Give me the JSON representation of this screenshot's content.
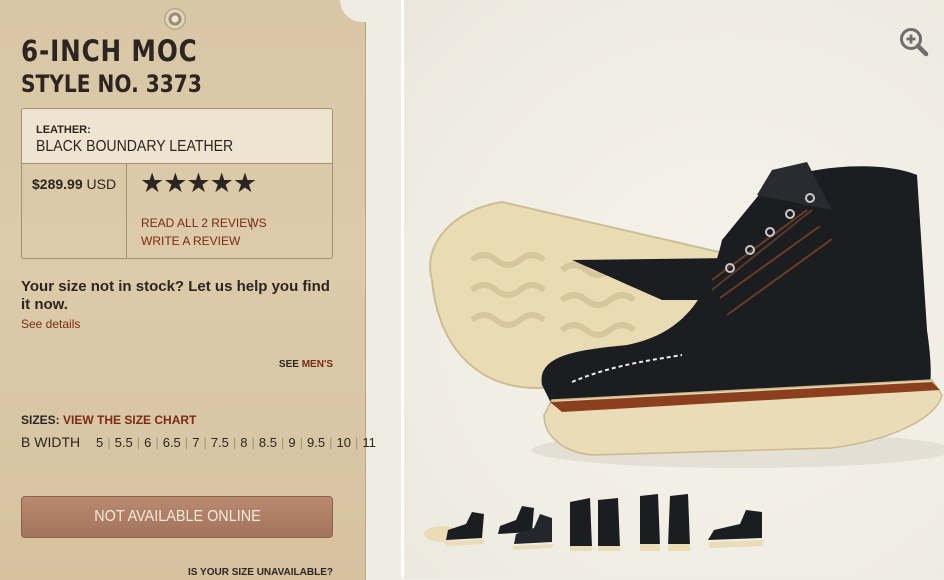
{
  "product": {
    "title": "6-INCH MOC",
    "style_no": "STYLE NO. 3373",
    "leather_label": "LEATHER:",
    "leather_value": "BLACK BOUNDARY LEATHER",
    "price": "$289.99",
    "currency": "USD",
    "rating_stars": 5,
    "stars_text": "★★★★★",
    "reviews_link": "READ ALL 2 REVIEWS",
    "separator": "|",
    "write_review": "WRITE A REVIEW"
  },
  "stock": {
    "message": "Your size not in stock? Let us help you find it now.",
    "details_link": "See details"
  },
  "alt_gender": {
    "prefix": "SEE",
    "link": "MEN'S"
  },
  "sizes": {
    "label": "SIZES:",
    "chart_link": "VIEW THE SIZE CHART",
    "width_label": "B WIDTH",
    "values": [
      "5",
      "5.5",
      "6",
      "6.5",
      "7",
      "7.5",
      "8",
      "8.5",
      "9",
      "9.5",
      "10",
      "11"
    ]
  },
  "cta": {
    "label": "NOT AVAILABLE ONLINE"
  },
  "footer": {
    "unavailable_link": "IS YOUR SIZE UNAVAILABLE?"
  },
  "gallery": {
    "zoom_icon": "zoom-in-icon",
    "thumbnails": [
      "side-pair",
      "three-quarter-pair",
      "front-pair",
      "back-pair",
      "side-single"
    ]
  },
  "colors": {
    "tag": "#d9c6a4",
    "link": "#7a2a18",
    "cta": "#a3735b",
    "leather": "#1c1d21",
    "sole": "#eadcb6",
    "welt": "#8c3f1f"
  }
}
